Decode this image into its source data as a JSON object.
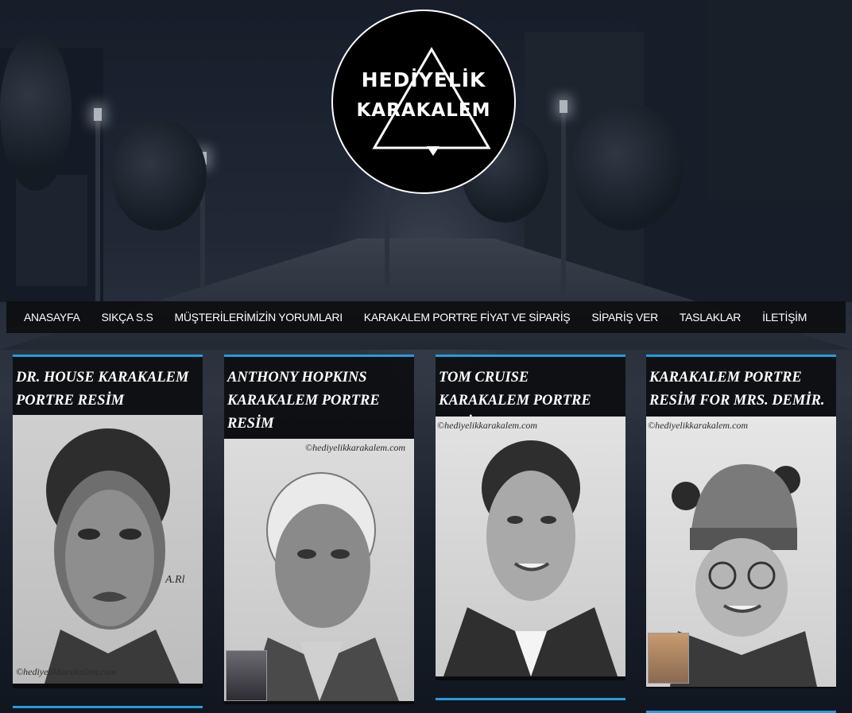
{
  "logo": {
    "line1": "HEDİYELİK",
    "line2": "KARAKALEM"
  },
  "nav": [
    {
      "label": "ANASAYFA"
    },
    {
      "label": "SIKÇA S.S"
    },
    {
      "label": "MÜŞTERİLERİMİZİN YORUMLARI"
    },
    {
      "label": "KARAKALEM PORTRE FİYAT VE SİPARİŞ"
    },
    {
      "label": "SİPARİŞ VER"
    },
    {
      "label": "TASLAKLAR"
    },
    {
      "label": "İLETİŞİM"
    }
  ],
  "posts": [
    {
      "title": "DR. HOUSE KARAKALEM PORTRE RESİM",
      "watermark": "©hediyelikkarakalem.com",
      "signature": "A.Rl"
    },
    {
      "title": "ANTHONY HOPKINS KARAKALEM PORTRE RESİM",
      "watermark": "©hediyelikkarakalem.com"
    },
    {
      "title": "TOM CRUISE KARAKALEM PORTRE RESİM",
      "watermark": "©hediyelikkarakalem.com"
    },
    {
      "title": "KARAKALEM PORTRE RESİM FOR MRS. DEMİR.",
      "watermark": "©hediyelikkarakalem.com"
    }
  ],
  "colors": {
    "accent": "#2a9bd8",
    "nav_bg": "#0c0c0e",
    "text": "#ffffff"
  }
}
